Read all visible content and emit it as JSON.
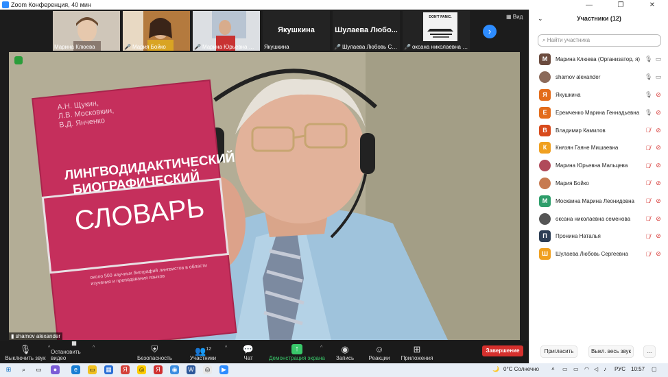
{
  "window": {
    "title": "Zoom Конференция, 40 мин",
    "controls": [
      "—",
      "❐",
      "✕"
    ]
  },
  "gallery": {
    "view_label": "Вид",
    "thumbnails": [
      {
        "name": "Марина Клюева",
        "muted": false,
        "type": "video",
        "color": "#d7cfc4"
      },
      {
        "name": "Мария Бойко",
        "muted": true,
        "type": "video",
        "color": "#c98a4a"
      },
      {
        "name": "Марина Юрьевна Ма...",
        "muted": true,
        "type": "video",
        "color": "#9aa7b8"
      },
      {
        "name": "Якушкина",
        "muted": false,
        "type": "name",
        "big_name": "Якушкина"
      },
      {
        "name": "Шулаева Любовь Сер...",
        "muted": true,
        "type": "name",
        "big_name": "Шулаева  Любо..."
      },
      {
        "name": "оксана николаевна се...",
        "muted": true,
        "type": "image",
        "big_name": "DON'T PANIC.",
        "color": "#eeeeee"
      }
    ]
  },
  "main_video": {
    "speaker": "shamov alexander",
    "book": {
      "authors": [
        "А.Н. Щукин,",
        "Л.В. Московкин,",
        "В.Д. Янченко"
      ],
      "title_line1": "ЛИНГВОДИДАКТИЧЕСКИЙ",
      "title_line2": "БИОГРАФИЧЕСКИЙ",
      "title_line3": "СЛОВАРЬ",
      "subtitle": "около 500 научных биографий лингвистов в области изучения и преподавания языков"
    }
  },
  "toolbar": {
    "mute": "Выключить звук",
    "stop_video": "Остановить видео",
    "security": "Безопасность",
    "participants": "Участники",
    "participants_count": "12",
    "chat": "Чат",
    "share": "Демонстрация экрана",
    "record": "Запись",
    "reactions": "Реакции",
    "apps": "Приложения",
    "end": "Завершение"
  },
  "participants_panel": {
    "title": "Участники (12)",
    "search_placeholder": "Найти участника",
    "items": [
      {
        "initial": "М",
        "name": "Марина Клюева (Организатор, я)",
        "color": "#6b4b3e",
        "mic": "on",
        "cam": "on"
      },
      {
        "initial": "",
        "name": "shamov alexander",
        "color": "#8b6a5a",
        "mic": "on",
        "cam": "on",
        "photo": true
      },
      {
        "initial": "Я",
        "name": "Якушкина",
        "color": "#e36c1b",
        "mic": "on",
        "cam": "off"
      },
      {
        "initial": "Е",
        "name": "Еремченко Марина Геннадьевна",
        "color": "#e36c1b",
        "mic": "on",
        "cam": "off"
      },
      {
        "initial": "В",
        "name": "Владимир Камилов",
        "color": "#d84a1b",
        "mic": "off",
        "cam": "off"
      },
      {
        "initial": "К",
        "name": "Князян Гаяне Мишаевна",
        "color": "#f0a020",
        "mic": "off",
        "cam": "off"
      },
      {
        "initial": "",
        "name": "Марина Юрьевна Мальцева",
        "color": "#b04a5a",
        "mic": "off",
        "cam": "off",
        "photo": true
      },
      {
        "initial": "",
        "name": "Мария Бойко",
        "color": "#c77a50",
        "mic": "off",
        "cam": "off",
        "photo": true
      },
      {
        "initial": "М",
        "name": "Москвина Марина Леонидовна",
        "color": "#2e9e6b",
        "mic": "off",
        "cam": "off"
      },
      {
        "initial": "",
        "name": "оксана николаевна семенова",
        "color": "#555555",
        "mic": "off",
        "cam": "off",
        "photo": true
      },
      {
        "initial": "П",
        "name": "Пронина Наталья",
        "color": "#2d3e55",
        "mic": "off",
        "cam": "off"
      },
      {
        "initial": "Ш",
        "name": "Шулаева Любовь Сергеевна",
        "color": "#f0a020",
        "mic": "off",
        "cam": "off"
      }
    ],
    "invite": "Пригласить",
    "mute_all": "Выкл. весь звук",
    "more": "..."
  },
  "taskbar": {
    "weather": "0°C  Солнечно",
    "lang": "РУС",
    "time": "10:57"
  },
  "colors": {
    "accent": "#2d8cff",
    "end": "#d5302d",
    "share": "#39c86a",
    "book": "#c52f5c"
  }
}
